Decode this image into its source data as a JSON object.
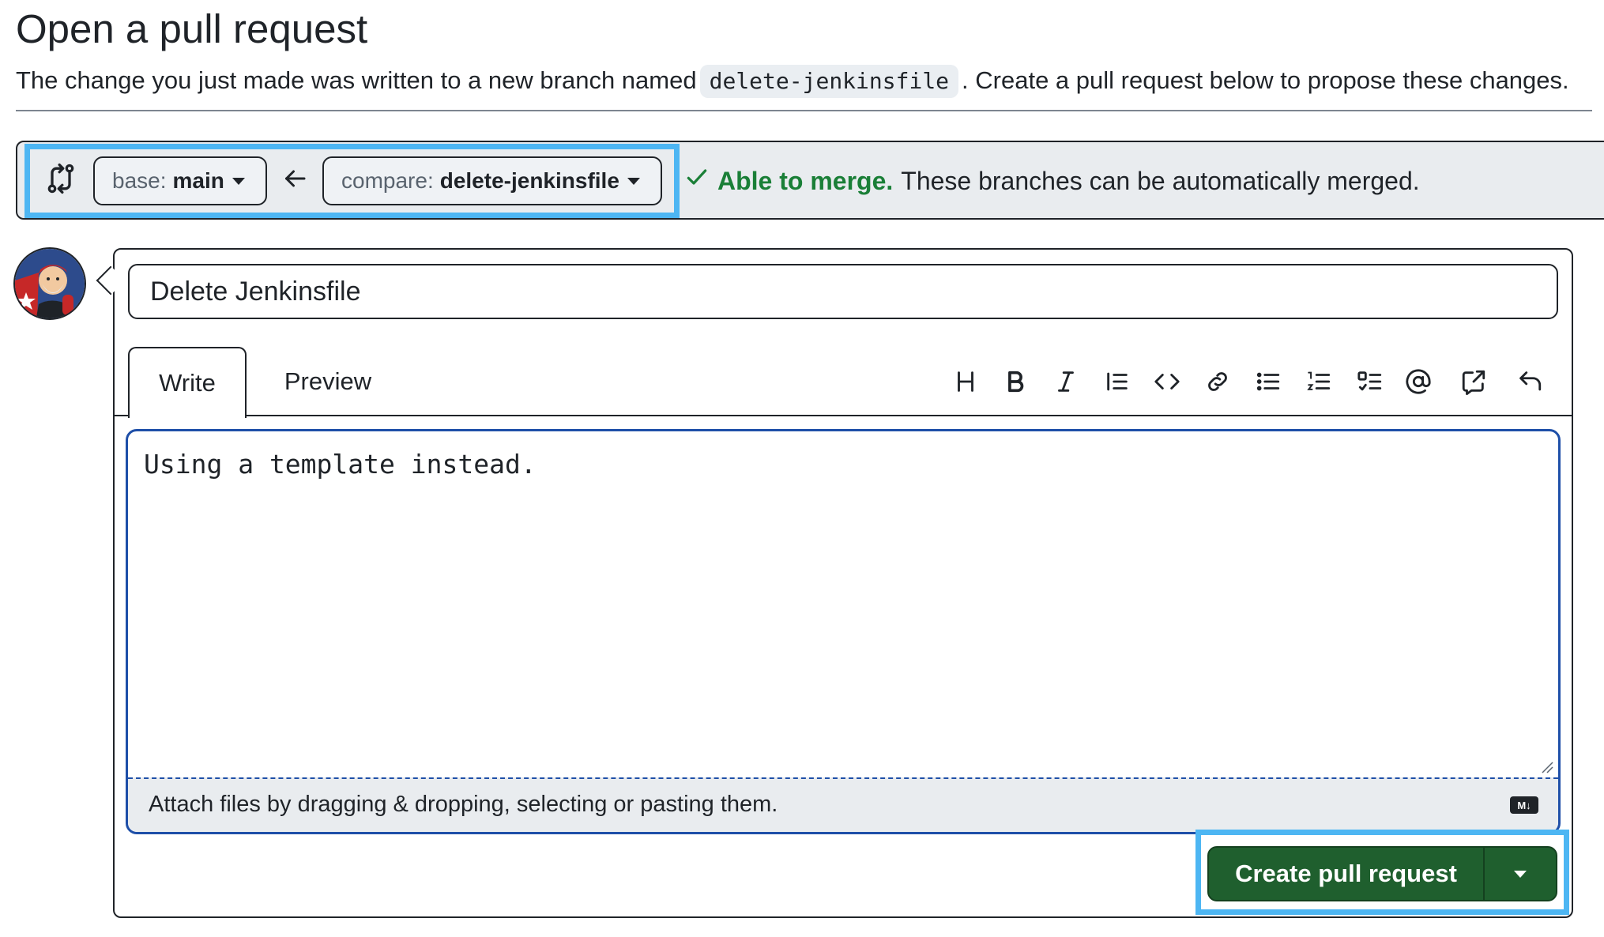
{
  "page": {
    "title": "Open a pull request",
    "intro_before": "The change you just made was written to a new branch named",
    "branch_chip": "delete-jenkinsfile",
    "intro_after": ". Create a pull request below to propose these changes."
  },
  "compare": {
    "base_label": "base:",
    "base_value": "main",
    "compare_label": "compare:",
    "compare_value": "delete-jenkinsfile",
    "merge_strong": "Able to merge.",
    "merge_text": "These branches can be automatically merged."
  },
  "form": {
    "title_value": "Delete Jenkinsfile",
    "tabs": [
      "Write",
      "Preview"
    ],
    "toolbar": [
      "heading-icon",
      "bold-icon",
      "italic-icon",
      "quote-icon",
      "code-icon",
      "link-icon",
      "bulleted-list-icon",
      "numbered-list-icon",
      "task-list-icon",
      "mention-icon",
      "reference-icon",
      "undo-icon"
    ],
    "body_value": "Using a template instead.",
    "attach_text": "Attach files by dragging & dropping, selecting or pasting them.",
    "submit_label": "Create pull request"
  },
  "colors": {
    "merge_green": "#1a7f37",
    "submit_green": "#1f5f2e",
    "focus_blue": "#1e4fa8",
    "highlight_blue": "#4db6f3"
  }
}
